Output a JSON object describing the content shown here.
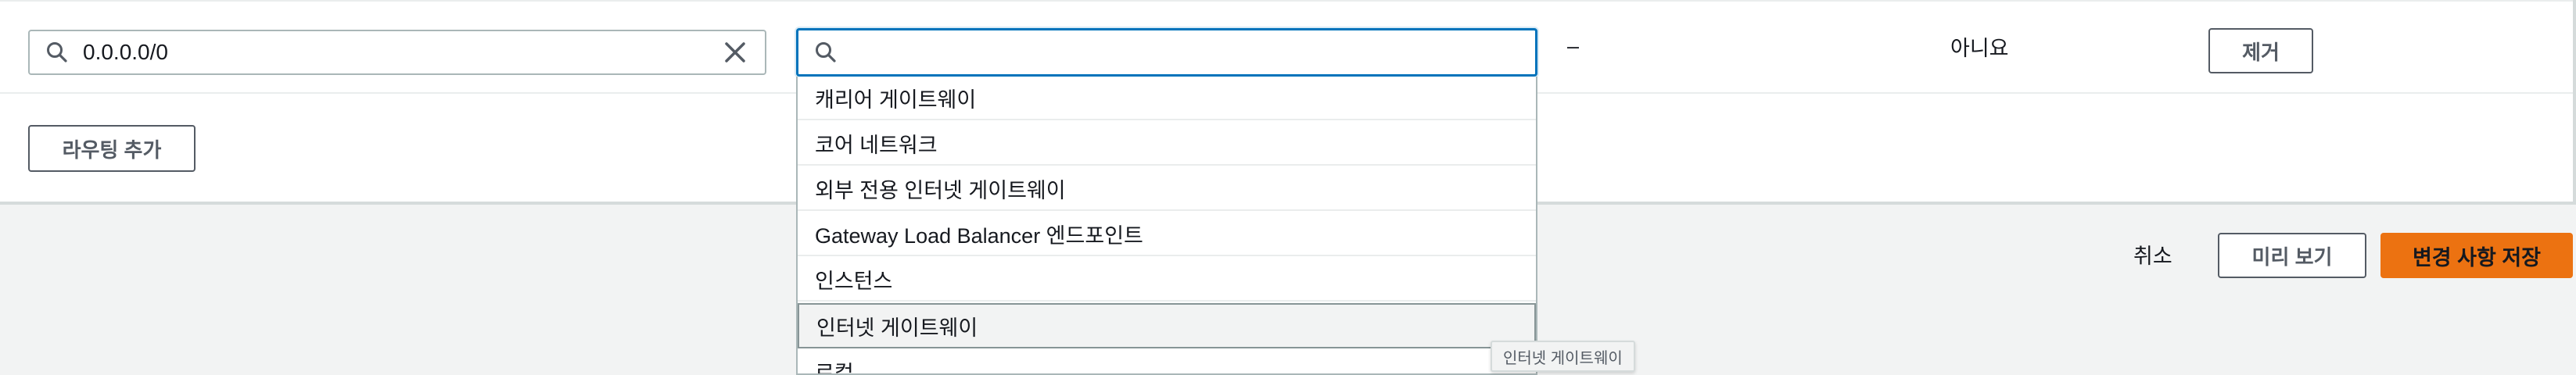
{
  "route_row": {
    "destination_value": "0.0.0.0/0",
    "target_value": "",
    "status": "–",
    "propagated": "아니요",
    "remove_label": "제거"
  },
  "add_route_label": "라우팅 추가",
  "target_options": [
    "캐리어 게이트웨이",
    "코어 네트워크",
    "외부 전용 인터넷 게이트웨이",
    "Gateway Load Balancer 엔드포인트",
    "인스턴스",
    "인터넷 게이트웨이",
    "로컬"
  ],
  "highlighted_option_index": 5,
  "tooltip": "인터넷 게이트웨이",
  "footer": {
    "cancel_label": "취소",
    "preview_label": "미리 보기",
    "save_label": "변경 사항 저장"
  },
  "icons": {
    "search": "search-icon",
    "clear": "close-icon"
  },
  "colors": {
    "primary": "#ec7211",
    "focus": "#0073bb",
    "footer_bg": "#f2f3f3"
  }
}
